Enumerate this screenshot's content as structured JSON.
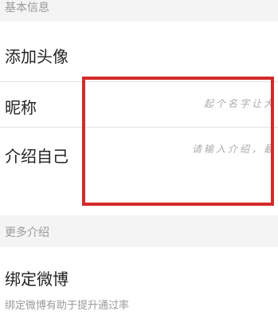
{
  "sections": {
    "basic_info": "基本信息",
    "more_intro": "更多介绍"
  },
  "rows": {
    "avatar": {
      "label": "添加头像"
    },
    "nickname": {
      "label": "昵称",
      "placeholder": "起个名字让大"
    },
    "intro": {
      "label": "介绍自己",
      "placeholder": "请输入介绍，最"
    },
    "weibo": {
      "label": "绑定微博",
      "subtitle": "绑定微博有助于提升通过率"
    }
  },
  "colors": {
    "highlight": "#d42a2a",
    "section_bg": "#f4f4f4"
  }
}
